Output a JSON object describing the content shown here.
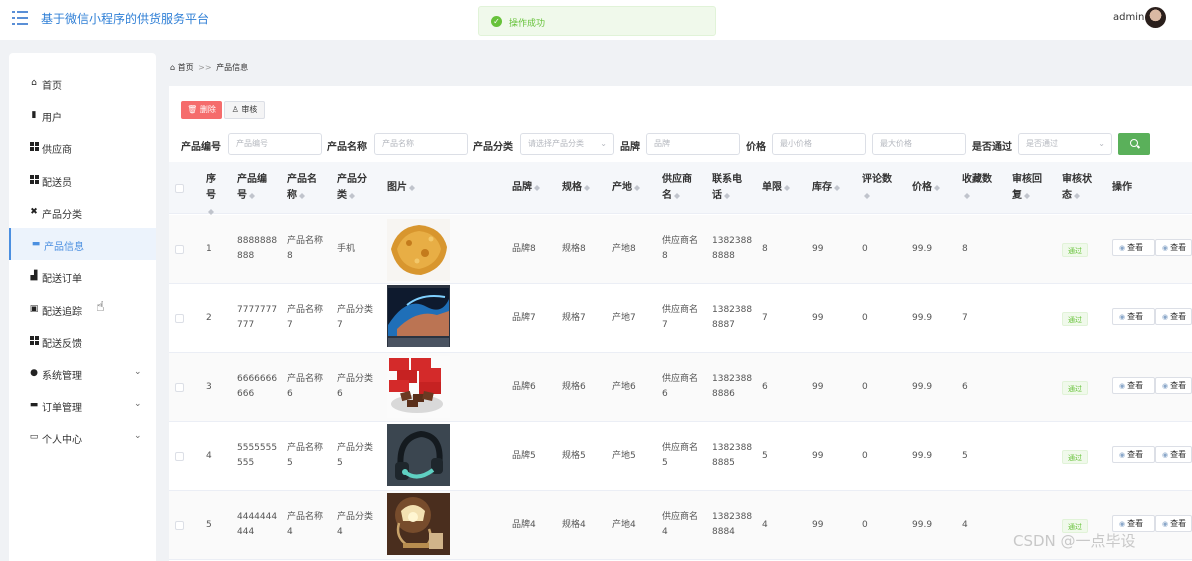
{
  "header": {
    "title": "基于微信小程序的供货服务平台",
    "toast": "操作成功",
    "user": "admin"
  },
  "sidebar": {
    "items": [
      {
        "label": "首页",
        "icon": "home-icon"
      },
      {
        "label": "用户",
        "icon": "user-icon"
      },
      {
        "label": "供应商",
        "icon": "grid-icon"
      },
      {
        "label": "配送员",
        "icon": "grid-icon"
      },
      {
        "label": "产品分类",
        "icon": "tag-icon"
      },
      {
        "label": "产品信息",
        "icon": "monitor-icon",
        "active": true
      },
      {
        "label": "配送订单",
        "icon": "chart-icon"
      },
      {
        "label": "配送追踪",
        "icon": "clipboard-icon"
      },
      {
        "label": "配送反馈",
        "icon": "grid-icon"
      },
      {
        "label": "系统管理",
        "icon": "pin-icon",
        "expandable": true
      },
      {
        "label": "订单管理",
        "icon": "monitor-icon",
        "expandable": true
      },
      {
        "label": "个人中心",
        "icon": "card-icon",
        "expandable": true
      }
    ]
  },
  "breadcrumb": {
    "home": "首页",
    "separator": ">>",
    "current": "产品信息"
  },
  "toolbar": {
    "delete": "删除",
    "audit": "审核"
  },
  "filters": {
    "code_label": "产品编号",
    "code_placeholder": "产品编号",
    "name_label": "产品名称",
    "name_placeholder": "产品名称",
    "category_label": "产品分类",
    "category_placeholder": "请选择产品分类",
    "brand_label": "品牌",
    "brand_placeholder": "品牌",
    "price_label": "价格",
    "price_min_placeholder": "最小价格",
    "price_max_placeholder": "最大价格",
    "approved_label": "是否通过",
    "approved_placeholder": "是否通过"
  },
  "table": {
    "headers": {
      "index": "序号",
      "code": "产品编号",
      "name": "产品名称",
      "category": "产品分类",
      "image": "图片",
      "brand": "品牌",
      "spec": "规格",
      "origin": "产地",
      "supplier": "供应商名",
      "phone": "联系电话",
      "limit": "单限",
      "stock": "库存",
      "reviews": "评论数",
      "price": "价格",
      "favorites": "收藏数",
      "reply": "审核回复",
      "status": "审核状态",
      "actions": "操作"
    },
    "rows": [
      {
        "index": "1",
        "code_a": "8888888",
        "code_b": "888",
        "name_a": "产品名称",
        "name_b": "8",
        "category_a": "手机",
        "category_b": "",
        "brand": "品牌8",
        "spec": "规格8",
        "origin": "产地8",
        "supplier_a": "供应商名",
        "supplier_b": "8",
        "phone_a": "1382388",
        "phone_b": "8888",
        "limit": "8",
        "stock": "99",
        "reviews": "0",
        "price": "99.9",
        "favorites": "8",
        "status": "通过",
        "action": "查看",
        "action2": "查看"
      },
      {
        "index": "2",
        "code_a": "7777777",
        "code_b": "777",
        "name_a": "产品名称",
        "name_b": "7",
        "category_a": "产品分类",
        "category_b": "7",
        "brand": "品牌7",
        "spec": "规格7",
        "origin": "产地7",
        "supplier_a": "供应商名",
        "supplier_b": "7",
        "phone_a": "1382388",
        "phone_b": "8887",
        "limit": "7",
        "stock": "99",
        "reviews": "0",
        "price": "99.9",
        "favorites": "7",
        "status": "通过",
        "action": "查看",
        "action2": "查看"
      },
      {
        "index": "3",
        "code_a": "6666666",
        "code_b": "666",
        "name_a": "产品名称",
        "name_b": "6",
        "category_a": "产品分类",
        "category_b": "6",
        "brand": "品牌6",
        "spec": "规格6",
        "origin": "产地6",
        "supplier_a": "供应商名",
        "supplier_b": "6",
        "phone_a": "1382388",
        "phone_b": "8886",
        "limit": "6",
        "stock": "99",
        "reviews": "0",
        "price": "99.9",
        "favorites": "6",
        "status": "通过",
        "action": "查看",
        "action2": "查看"
      },
      {
        "index": "4",
        "code_a": "5555555",
        "code_b": "555",
        "name_a": "产品名称",
        "name_b": "5",
        "category_a": "产品分类",
        "category_b": "5",
        "brand": "品牌5",
        "spec": "规格5",
        "origin": "产地5",
        "supplier_a": "供应商名",
        "supplier_b": "5",
        "phone_a": "1382388",
        "phone_b": "8885",
        "limit": "5",
        "stock": "99",
        "reviews": "0",
        "price": "99.9",
        "favorites": "5",
        "status": "通过",
        "action": "查看",
        "action2": "查看"
      },
      {
        "index": "5",
        "code_a": "4444444",
        "code_b": "444",
        "name_a": "产品名称",
        "name_b": "4",
        "category_a": "产品分类",
        "category_b": "4",
        "brand": "品牌4",
        "spec": "规格4",
        "origin": "产地4",
        "supplier_a": "供应商名",
        "supplier_b": "4",
        "phone_a": "1382388",
        "phone_b": "8884",
        "limit": "4",
        "stock": "99",
        "reviews": "0",
        "price": "99.9",
        "favorites": "4",
        "status": "通过",
        "action": "查看",
        "action2": "查看"
      }
    ]
  },
  "watermark": "CSDN @一点毕设"
}
